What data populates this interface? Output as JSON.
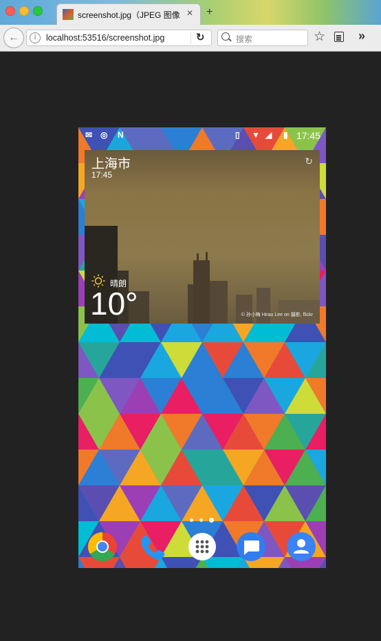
{
  "browser": {
    "tab_title": "screenshot.jpg（JPEG 图像...",
    "tab_close": "✕",
    "new_tab": "+",
    "url": "localhost:53516/screenshot.jpg",
    "search_placeholder": "搜索",
    "titlebar_decoration": "Lucky"
  },
  "phone": {
    "statusbar": {
      "time": "17:45"
    },
    "weather_widget": {
      "city": "上海市",
      "time": "17:45",
      "condition": "晴朗",
      "temperature": "10°",
      "photo_credit": "© 孙小梅 Hirao Lee on 摄影, flickr"
    },
    "home_pages": {
      "count": 3
    },
    "dock": [
      "chrome-icon",
      "phone-icon",
      "app-drawer-icon",
      "messages-icon",
      "contacts-icon"
    ]
  },
  "colors": {
    "desktop_bg": "#222222",
    "chrome_red": "#ea4335",
    "chrome_yellow": "#fbbc05",
    "chrome_green": "#34a853",
    "chrome_blue": "#4285f4",
    "phone_blue": "#2196f3",
    "messages_blue": "#2f7df0",
    "contacts_blue": "#3b82f6"
  }
}
